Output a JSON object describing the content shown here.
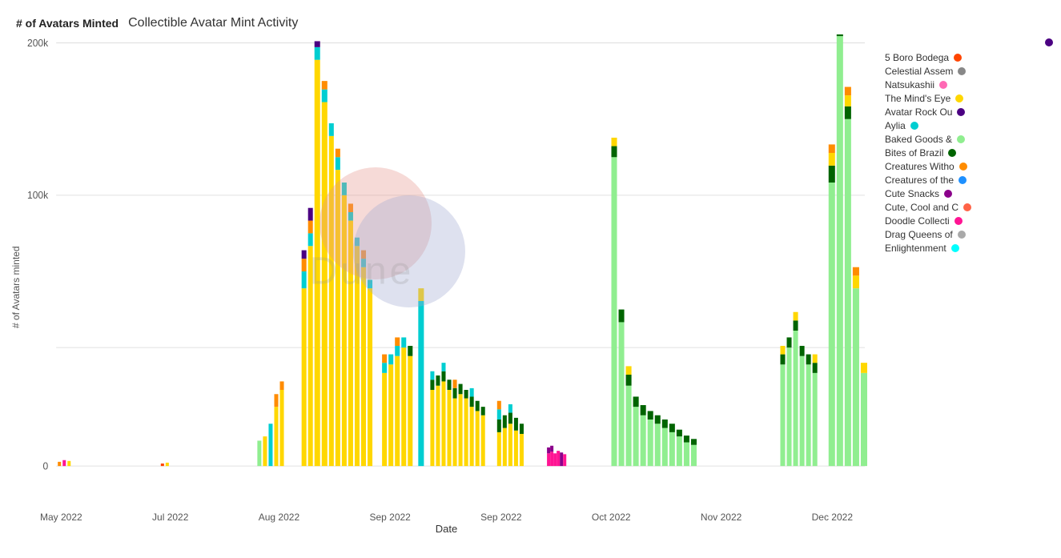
{
  "header": {
    "y_axis_title": "# of Avatars Minted",
    "chart_title": "Collectible Avatar Mint Activity",
    "y_axis_label": "# of Avatars minted",
    "x_axis_label": "Date",
    "watermark": "Dune"
  },
  "y_axis_ticks": [
    "200k",
    "100k",
    "0"
  ],
  "x_axis_labels": [
    "May 2022",
    "Jul 2022",
    "Aug 2022",
    "Sep 2022",
    "Sep 2022",
    "Oct 2022",
    "Nov 2022",
    "Dec 2022"
  ],
  "legend_items": [
    {
      "label": "5 Boro Bodega",
      "color": "#FF4500"
    },
    {
      "label": "Celestial Assem",
      "color": "#888888"
    },
    {
      "label": "Natsukashii",
      "color": "#FF69B4"
    },
    {
      "label": "The Mind's Eye",
      "color": "#FFD700"
    },
    {
      "label": "Avatar Rock Ou",
      "color": "#4B0082"
    },
    {
      "label": "Aylia",
      "color": "#00CED1"
    },
    {
      "label": "Baked Goods &",
      "color": "#90EE90"
    },
    {
      "label": "Bites of Brazil",
      "color": "#006400"
    },
    {
      "label": "Creatures Witho",
      "color": "#FF8C00"
    },
    {
      "label": "Creatures of the",
      "color": "#1E90FF"
    },
    {
      "label": "Cute Snacks",
      "color": "#8B008B"
    },
    {
      "label": "Cute, Cool and C",
      "color": "#FF6347"
    },
    {
      "label": "Doodle Collecti",
      "color": "#FF1493"
    },
    {
      "label": "Drag Queens of",
      "color": "#A9A9A9"
    },
    {
      "label": "Enlightenment",
      "color": "#00FFFF"
    }
  ],
  "top_legend_dot": "#4B0082"
}
